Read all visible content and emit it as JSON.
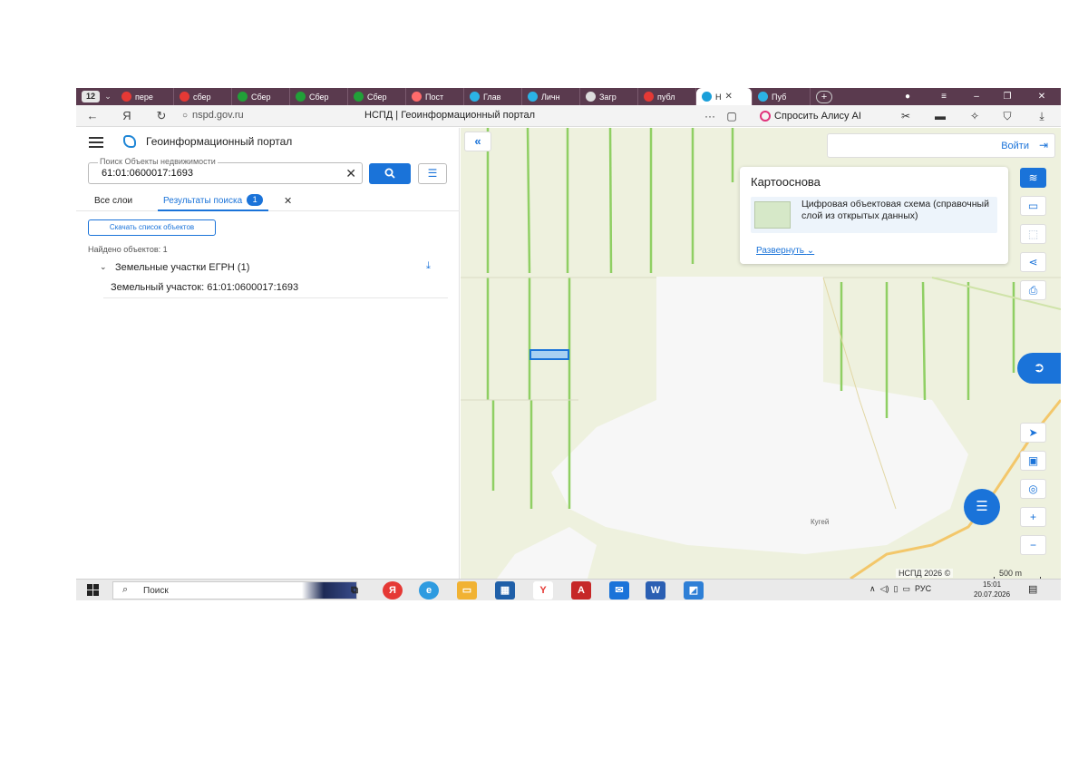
{
  "browser": {
    "tab_count": "12",
    "tabs": [
      {
        "label": "пере",
        "color": "#e53935"
      },
      {
        "label": "сбер",
        "color": "#e53935"
      },
      {
        "label": "Сбер",
        "color": "#21a038"
      },
      {
        "label": "Сбер",
        "color": "#21a038"
      },
      {
        "label": "Сбер",
        "color": "#21a038"
      },
      {
        "label": "Пост",
        "color": "#ff6b6b"
      },
      {
        "label": "Глав",
        "color": "#2bb3e6"
      },
      {
        "label": "Личн",
        "color": "#2bb3e6"
      },
      {
        "label": "Загр",
        "color": "#dddddd"
      },
      {
        "label": "публ",
        "color": "#e53935"
      },
      {
        "label": "Н",
        "color": "#1a9fd9",
        "active": true
      },
      {
        "label": "Пуб",
        "color": "#2bb3e6"
      }
    ],
    "url": "nspd.gov.ru",
    "page_title": "НСПД | Геоинформационный портал",
    "alice_label": "Спросить Алису AI"
  },
  "panel": {
    "portal_title": "Геоинформационный портал",
    "search_label": "Поиск Объекты недвижимости",
    "search_value": "61:01:0600017:1693",
    "tab_all": "Все слои",
    "tab_results": "Результаты поиска",
    "results_badge": "1",
    "download_label": "Скачать список объектов",
    "found_count": "Найдено объектов: 1",
    "group_header": "Земельные участки ЕГРН (1)",
    "result_item": "Земельный участок: 61:01:0600017:1693"
  },
  "map": {
    "login_label": "Войти",
    "basemap_title": "Картооснова",
    "basemap_description": "Цифровая объектовая схема (справочный слой из открытых данных)",
    "basemap_expand": "Развернуть",
    "attribution": "НСПД 2026 ©",
    "scale": "500 m",
    "place_label": "Кугей",
    "colors": {
      "field": "#eef1de",
      "strip": "#8fcf63",
      "urban": "#f7f7f7",
      "road": "#f3c76a",
      "highlight": "#5fa8e8",
      "accent": "#1a73d9"
    }
  },
  "taskbar": {
    "search_placeholder": "Поиск",
    "tray_language": "РУС",
    "time": "15:01",
    "date": "20.07.2026"
  }
}
